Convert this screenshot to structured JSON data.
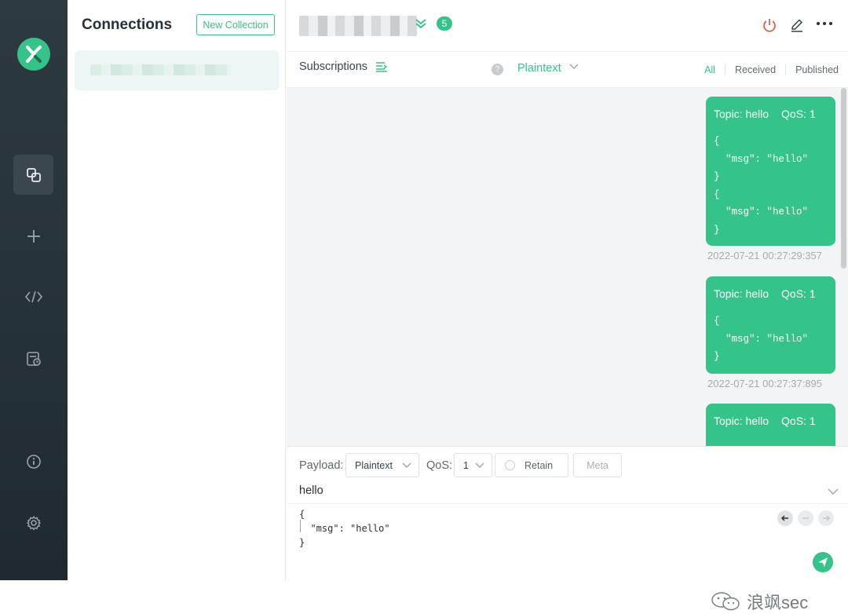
{
  "rail": {
    "logo": "mqttx-logo-icon",
    "items": [
      {
        "icon": "connections-icon",
        "active": true
      },
      {
        "icon": "plus-icon"
      },
      {
        "icon": "code-icon"
      },
      {
        "icon": "log-icon"
      },
      {
        "icon": "info-icon"
      },
      {
        "icon": "gear-icon"
      }
    ]
  },
  "connections": {
    "title": "Connections",
    "new_collection": "New Collection"
  },
  "topbar": {
    "badge": "5"
  },
  "subbar": {
    "subscriptions_label": "Subscriptions",
    "help": "?",
    "format": "Plaintext",
    "filters": [
      "All",
      "Received",
      "Published"
    ]
  },
  "messages": [
    {
      "topic": "Topic: hello",
      "qos": "QoS: 1",
      "payload": "{\n  \"msg\": \"hello\"\n}\n{\n  \"msg\": \"hello\"\n}",
      "time": "2022-07-21 00:27:29:357"
    },
    {
      "topic": "Topic: hello",
      "qos": "QoS: 1",
      "payload": "{\n  \"msg\": \"hello\"\n}",
      "time": "2022-07-21 00:27:37:895"
    },
    {
      "topic": "Topic: hello",
      "qos": "QoS: 1",
      "payload": "",
      "time": ""
    }
  ],
  "composer": {
    "payload_label": "Payload:",
    "payload_format": "Plaintext",
    "qos_label": "QoS:",
    "qos_value": "1",
    "retain": "Retain",
    "meta": "Meta",
    "topic": "hello",
    "payload": "{\n  \"msg\": \"hello\"\n}",
    "watermark": "浪飒sec"
  },
  "colors": {
    "accent": "#34c388",
    "rail": "#253238",
    "danger": "#e0584c"
  }
}
